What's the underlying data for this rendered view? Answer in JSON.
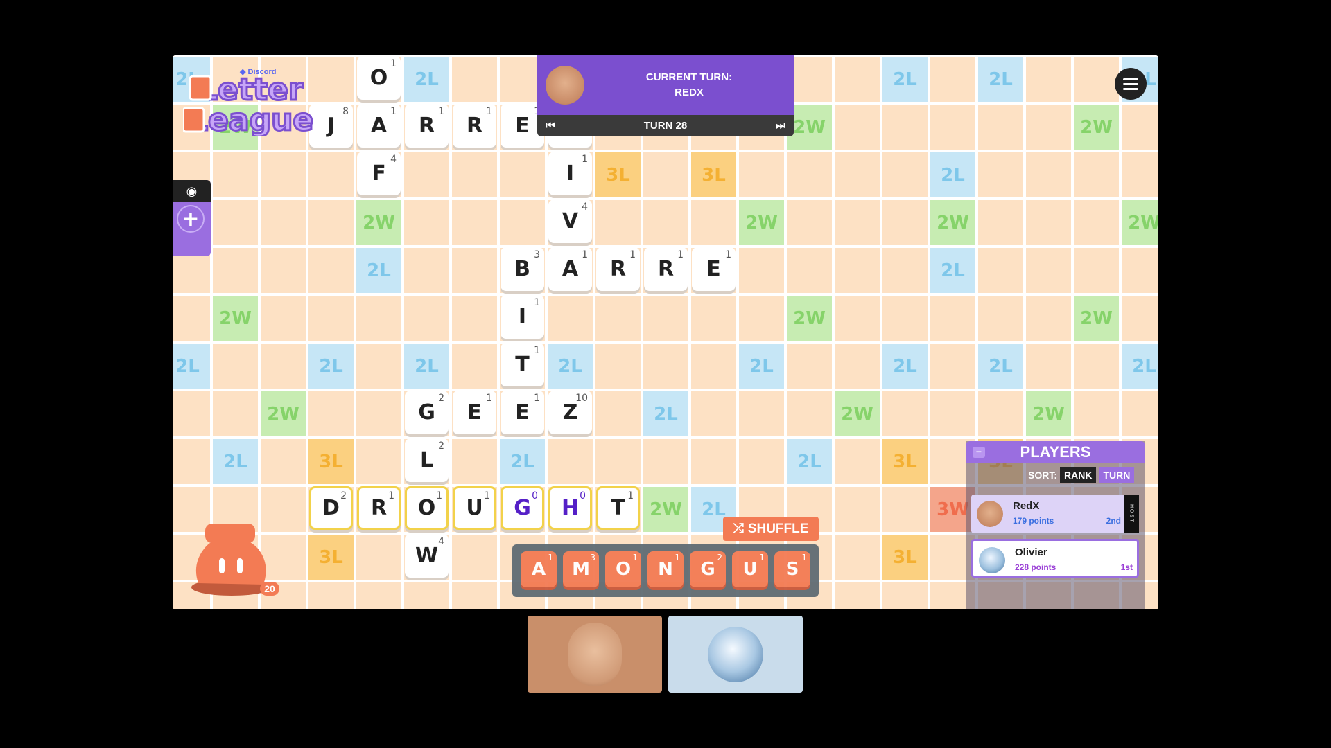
{
  "app": {
    "brand": "Discord",
    "title": "Letter League"
  },
  "header": {
    "current_turn_label": "CURRENT TURN:",
    "current_player": "REDX",
    "turn_label": "TURN 28",
    "prev_icon": "skip-back-icon",
    "next_icon": "skip-forward-icon"
  },
  "menu": {
    "icon": "hamburger-menu-icon"
  },
  "side": {
    "eye_icon": "eye-icon",
    "add_icon": "plus-icon"
  },
  "bag": {
    "count": "20"
  },
  "shuffle": {
    "label": "SHUFFLE",
    "icon": "shuffle-icon"
  },
  "rack": [
    {
      "letter": "A",
      "pts": "1"
    },
    {
      "letter": "M",
      "pts": "3"
    },
    {
      "letter": "O",
      "pts": "1"
    },
    {
      "letter": "N",
      "pts": "1"
    },
    {
      "letter": "G",
      "pts": "2"
    },
    {
      "letter": "U",
      "pts": "1"
    },
    {
      "letter": "S",
      "pts": "1"
    }
  ],
  "players_panel": {
    "title": "PLAYERS",
    "sort_label": "SORT:",
    "sort_rank": "RANK",
    "sort_turn": "TURN",
    "host_tag": "HOST",
    "players": [
      {
        "name": "RedX",
        "points": "179 points",
        "rank": "2nd"
      },
      {
        "name": "Olivier",
        "points": "228 points",
        "rank": "1st"
      }
    ]
  },
  "colors": {
    "board": "#fde1c4",
    "double_letter": "#c6e6f6",
    "double_word": "#c7ecb2",
    "triple_letter": "#fbd080",
    "triple_word": "#f4a58b",
    "accent": "#7b4fcf",
    "rack_tile": "#f37b54"
  },
  "board": {
    "premium_squares": [
      {
        "c": 0,
        "r": 0,
        "t": "2L"
      },
      {
        "c": 5,
        "r": 0,
        "t": "2L"
      },
      {
        "c": 15,
        "r": 0,
        "t": "2L"
      },
      {
        "c": 17,
        "r": 0,
        "t": "2L"
      },
      {
        "c": 20,
        "r": 0,
        "t": "2L"
      },
      {
        "c": 1,
        "r": 1,
        "t": "2W"
      },
      {
        "c": 13,
        "r": 1,
        "t": "2W"
      },
      {
        "c": 19,
        "r": 1,
        "t": "2W"
      },
      {
        "c": 9,
        "r": 2,
        "t": "3L"
      },
      {
        "c": 11,
        "r": 2,
        "t": "3L"
      },
      {
        "c": 16,
        "r": 2,
        "t": "2L"
      },
      {
        "c": 4,
        "r": 3,
        "t": "2W"
      },
      {
        "c": 12,
        "r": 3,
        "t": "2W"
      },
      {
        "c": 16,
        "r": 3,
        "t": "2W"
      },
      {
        "c": 20,
        "r": 3,
        "t": "2W"
      },
      {
        "c": 4,
        "r": 4,
        "t": "2L"
      },
      {
        "c": 16,
        "r": 4,
        "t": "2L"
      },
      {
        "c": 1,
        "r": 5,
        "t": "2W"
      },
      {
        "c": 13,
        "r": 5,
        "t": "2W"
      },
      {
        "c": 19,
        "r": 5,
        "t": "2W"
      },
      {
        "c": 0,
        "r": 6,
        "t": "2L"
      },
      {
        "c": 3,
        "r": 6,
        "t": "2L"
      },
      {
        "c": 5,
        "r": 6,
        "t": "2L"
      },
      {
        "c": 8,
        "r": 6,
        "t": "2L"
      },
      {
        "c": 12,
        "r": 6,
        "t": "2L"
      },
      {
        "c": 15,
        "r": 6,
        "t": "2L"
      },
      {
        "c": 17,
        "r": 6,
        "t": "2L"
      },
      {
        "c": 20,
        "r": 6,
        "t": "2L"
      },
      {
        "c": 2,
        "r": 7,
        "t": "2W"
      },
      {
        "c": 10,
        "r": 7,
        "t": "2L"
      },
      {
        "c": 14,
        "r": 7,
        "t": "2W"
      },
      {
        "c": 18,
        "r": 7,
        "t": "2W"
      },
      {
        "c": 1,
        "r": 8,
        "t": "2L"
      },
      {
        "c": 3,
        "r": 8,
        "t": "3L"
      },
      {
        "c": 7,
        "r": 8,
        "t": "2L"
      },
      {
        "c": 13,
        "r": 8,
        "t": "2L"
      },
      {
        "c": 15,
        "r": 8,
        "t": "3L"
      },
      {
        "c": 17,
        "r": 8,
        "t": "3L"
      },
      {
        "c": 10,
        "r": 9,
        "t": "2W"
      },
      {
        "c": 11,
        "r": 9,
        "t": "2L"
      },
      {
        "c": 16,
        "r": 9,
        "t": "3W"
      },
      {
        "c": 3,
        "r": 10,
        "t": "3L"
      },
      {
        "c": 15,
        "r": 10,
        "t": "3L"
      }
    ],
    "tiles": [
      {
        "c": 4,
        "r": 0,
        "l": "O",
        "p": "1"
      },
      {
        "c": 3,
        "r": 1,
        "l": "J",
        "p": "8"
      },
      {
        "c": 4,
        "r": 1,
        "l": "A",
        "p": "1"
      },
      {
        "c": 5,
        "r": 1,
        "l": "R",
        "p": "1"
      },
      {
        "c": 6,
        "r": 1,
        "l": "R",
        "p": "1"
      },
      {
        "c": 7,
        "r": 1,
        "l": "E",
        "p": "1"
      },
      {
        "c": 8,
        "r": 1,
        "l": "D",
        "p": "2"
      },
      {
        "c": 4,
        "r": 2,
        "l": "F",
        "p": "4"
      },
      {
        "c": 8,
        "r": 2,
        "l": "I",
        "p": "1"
      },
      {
        "c": 8,
        "r": 3,
        "l": "V",
        "p": "4"
      },
      {
        "c": 7,
        "r": 4,
        "l": "B",
        "p": "3"
      },
      {
        "c": 8,
        "r": 4,
        "l": "A",
        "p": "1"
      },
      {
        "c": 9,
        "r": 4,
        "l": "R",
        "p": "1"
      },
      {
        "c": 10,
        "r": 4,
        "l": "R",
        "p": "1"
      },
      {
        "c": 11,
        "r": 4,
        "l": "E",
        "p": "1"
      },
      {
        "c": 7,
        "r": 5,
        "l": "I",
        "p": "1"
      },
      {
        "c": 7,
        "r": 6,
        "l": "T",
        "p": "1"
      },
      {
        "c": 5,
        "r": 7,
        "l": "G",
        "p": "2"
      },
      {
        "c": 6,
        "r": 7,
        "l": "E",
        "p": "1"
      },
      {
        "c": 7,
        "r": 7,
        "l": "E",
        "p": "1"
      },
      {
        "c": 8,
        "r": 7,
        "l": "Z",
        "p": "10"
      },
      {
        "c": 5,
        "r": 8,
        "l": "L",
        "p": "2"
      },
      {
        "c": 3,
        "r": 9,
        "l": "D",
        "p": "2",
        "pend": true
      },
      {
        "c": 4,
        "r": 9,
        "l": "R",
        "p": "1",
        "pend": true
      },
      {
        "c": 5,
        "r": 9,
        "l": "O",
        "p": "1",
        "pend": true
      },
      {
        "c": 6,
        "r": 9,
        "l": "U",
        "p": "1",
        "pend": true
      },
      {
        "c": 7,
        "r": 9,
        "l": "G",
        "p": "0",
        "pend": true,
        "blank": true
      },
      {
        "c": 8,
        "r": 9,
        "l": "H",
        "p": "0",
        "pend": true,
        "blank": true
      },
      {
        "c": 9,
        "r": 9,
        "l": "T",
        "p": "1",
        "pend": true
      },
      {
        "c": 5,
        "r": 10,
        "l": "W",
        "p": "4"
      }
    ]
  }
}
